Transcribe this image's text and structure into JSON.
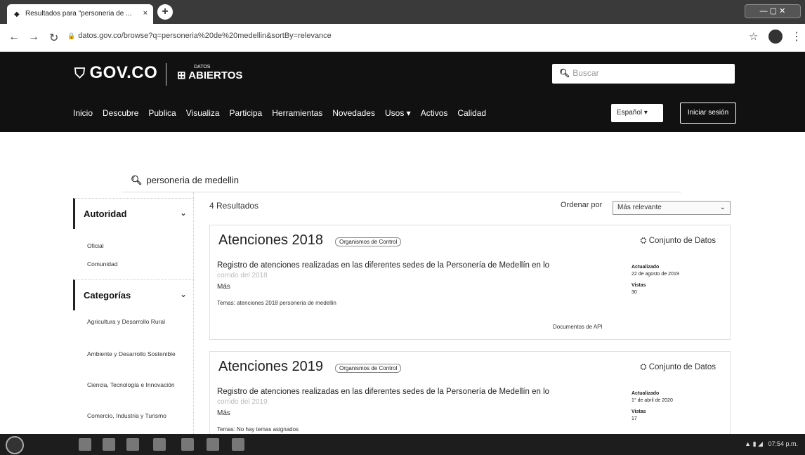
{
  "browser": {
    "tab_title": "Resultados para \"personeria de ...",
    "tab_close": "×",
    "new_tab": "+",
    "url": "datos.gov.co/browse?q=personeria%20de%20medellin&sortBy=relevance"
  },
  "header": {
    "logo_text": "GOV.CO",
    "datos_small": "DATOS",
    "datos_big": "ABIERTOS",
    "search_placeholder": "Buscar",
    "nav": [
      "Inicio",
      "Descubre",
      "Publica",
      "Visualiza",
      "Participa",
      "Herramientas",
      "Novedades",
      "Usos ▾",
      "Activos",
      "Calidad"
    ],
    "language": "Español ▾",
    "login": "Iniciar sesión"
  },
  "query": {
    "value": "personeria de medellin"
  },
  "sidebar": {
    "authority_title": "Autoridad",
    "authority_items": [
      "Oficial",
      "Comunidad"
    ],
    "categories_title": "Categorías",
    "category_items": [
      "Agricultura y Desarrollo Rural",
      "Ambiente y Desarrollo Sostenible",
      "Ciencia, Tecnología e Innovación",
      "Comercio, Industria y Turismo"
    ]
  },
  "results": {
    "count_text": "4 Resultados",
    "sort_label": "Ordenar por",
    "sort_value": "Más relevante",
    "items": [
      {
        "title": "Atenciones 2018",
        "badge": "Organismos de Control",
        "type": "Conjunto de Datos",
        "description": "Registro de atenciones realizadas en las diferentes sedes de la Personería de Medellín en lo",
        "faded": "corrido del 2018",
        "more": "Más",
        "tags": "Temas: atenciones 2018 personeria de medellin",
        "updated_label": "Actualizado",
        "updated_value": "22 de agosto de 2019",
        "views_label": "Vistas",
        "views_value": "30",
        "api": "Documentos de API"
      },
      {
        "title": "Atenciones 2019",
        "badge": "Organismos de Control",
        "type": "Conjunto de Datos",
        "description": "Registro de atenciones realizadas en las diferentes sedes de la Personería de Medellín en lo",
        "faded": "corrido del 2019",
        "more": "Más",
        "tags": "Temas: No hay temas asignados",
        "updated_label": "Actualizado",
        "updated_value": "1° de abril de 2020",
        "views_label": "Vistas",
        "views_value": "17"
      }
    ]
  },
  "taskbar": {
    "clock": "07:54 p.m."
  }
}
